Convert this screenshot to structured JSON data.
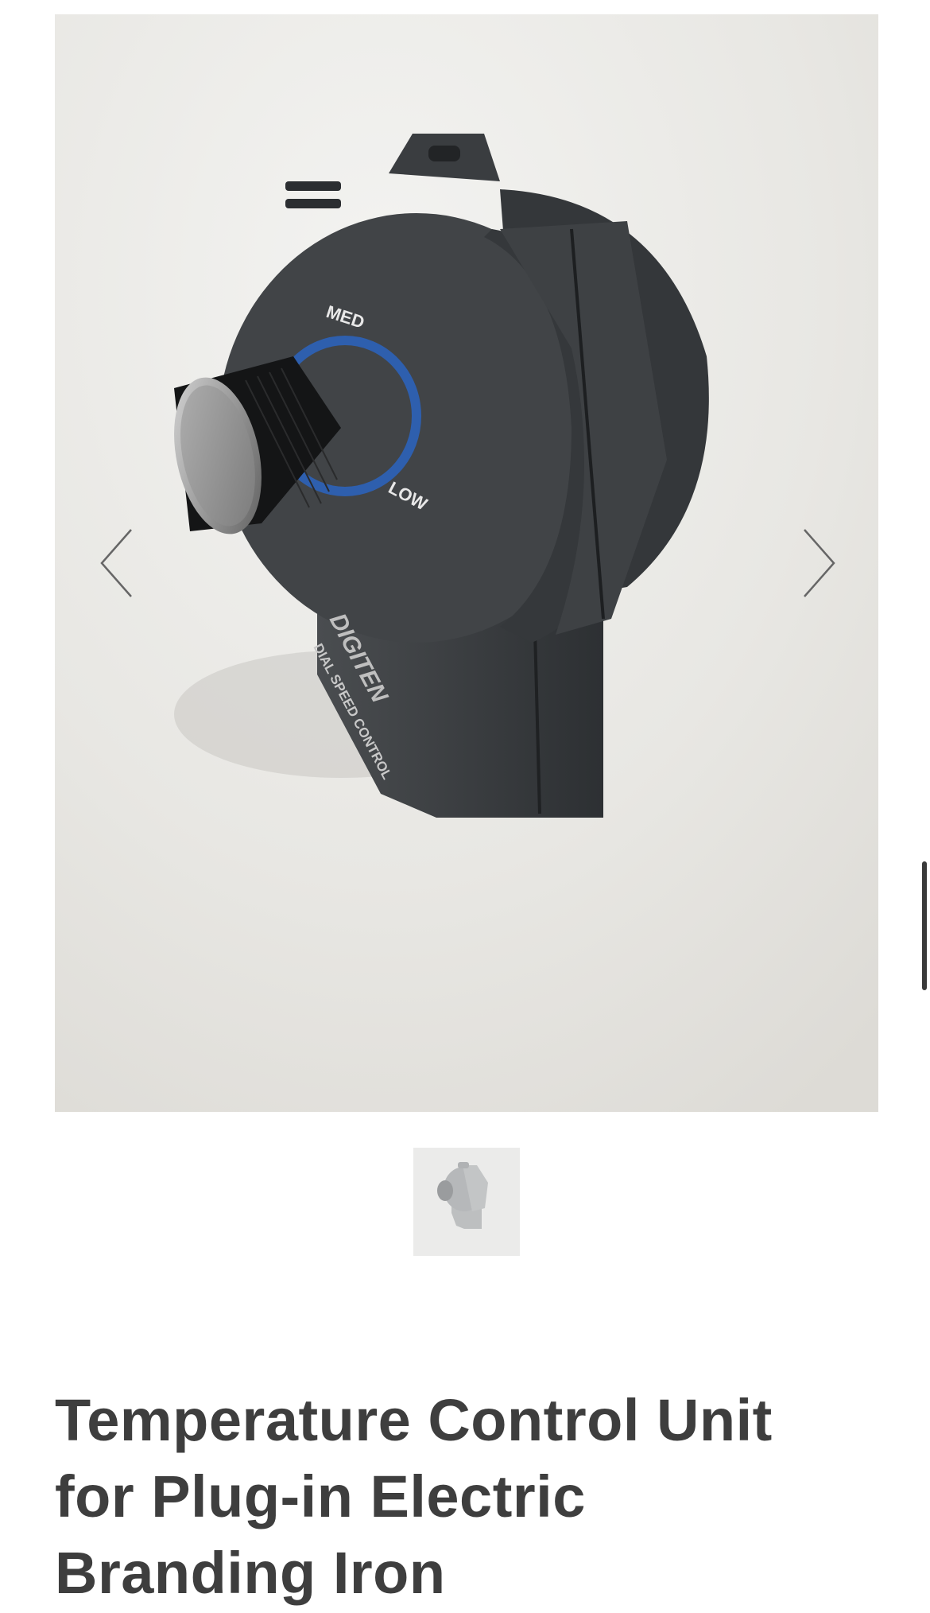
{
  "gallery": {
    "dial_labels": {
      "med": "MED",
      "low": "LOW"
    },
    "brand_logo_text": "DIGITEN",
    "device_label": "DIAL SPEED CONTROL",
    "prev_icon": "chevron-left-icon",
    "next_icon": "chevron-right-icon"
  },
  "product": {
    "title": "Temperature Control Unit for Plug-in Electric Branding Iron"
  },
  "colors": {
    "device_body": "#3b3e40",
    "dial_ring": "#2e5fae",
    "title_text": "#3e3e3e",
    "background": "#e9e9e6"
  }
}
